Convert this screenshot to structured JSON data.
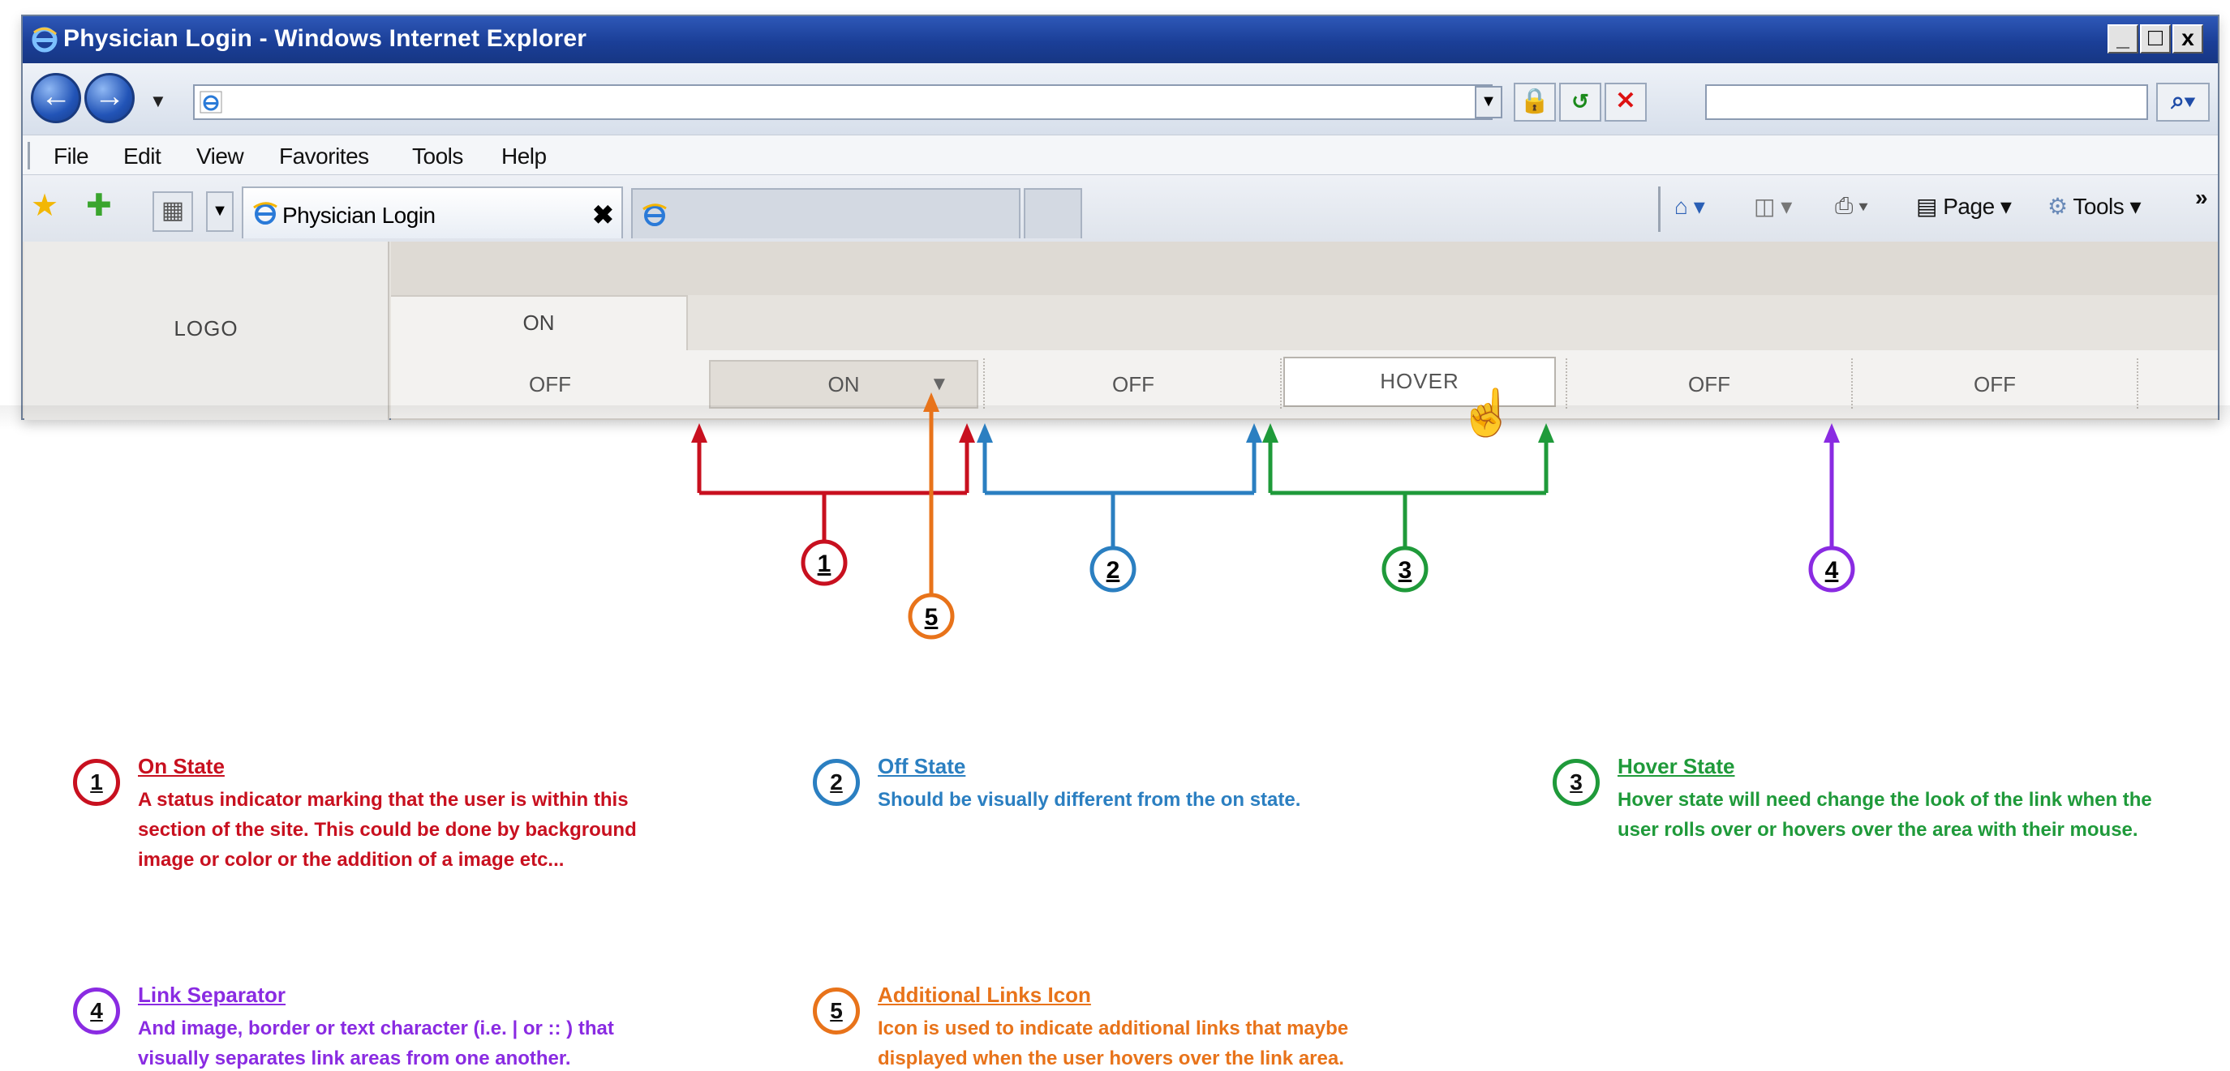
{
  "browser": {
    "window_title": "Physician Login - Windows Internet Explorer",
    "controls": {
      "minimize": "_",
      "maximize": "□",
      "close": "x"
    },
    "address": {
      "value": ""
    },
    "search": {
      "placeholder": ""
    },
    "menu": [
      "File",
      "Edit",
      "View",
      "Favorites",
      "Tools",
      "Help"
    ],
    "tabs": [
      {
        "label": "Physician Login",
        "active": true
      },
      {
        "label": "",
        "active": false
      },
      {
        "label": "",
        "active": false
      }
    ],
    "command_bar": {
      "page": "Page",
      "tools": "Tools"
    }
  },
  "site": {
    "logo": "LOGO",
    "top_tab": "ON",
    "nav": [
      "OFF",
      "ON",
      "OFF",
      "HOVER",
      "OFF",
      "OFF"
    ],
    "colors": {
      "content_bg": "#e6e3de",
      "nav_bg": "#f3f2f0"
    }
  },
  "callouts": {
    "c1": "1",
    "c2": "2",
    "c3": "3",
    "c4": "4",
    "c5": "5",
    "colors": {
      "1": "#c8101f",
      "2": "#2b7fc1",
      "3": "#1f9a3a",
      "4": "#8a2be2",
      "5": "#e8731a"
    }
  },
  "legend": [
    {
      "num": "1",
      "title": "On State",
      "description": "A status indicator marking that the user is within this section of the site. This could be done by background image or color or the addition of a image etc..."
    },
    {
      "num": "2",
      "title": "Off State",
      "description": "Should be visually different from the on state."
    },
    {
      "num": "3",
      "title": "Hover State",
      "description": "Hover state will need change the look of the link when the user rolls over or hovers over the area with their mouse."
    },
    {
      "num": "4",
      "title": "Link Separator",
      "description": "And image, border or text character (i.e. | or :: ) that visually separates link areas from one another."
    },
    {
      "num": "5",
      "title": "Additional Links Icon",
      "description": "Icon is used to indicate additional links that maybe displayed when the user hovers over the link area."
    }
  ]
}
